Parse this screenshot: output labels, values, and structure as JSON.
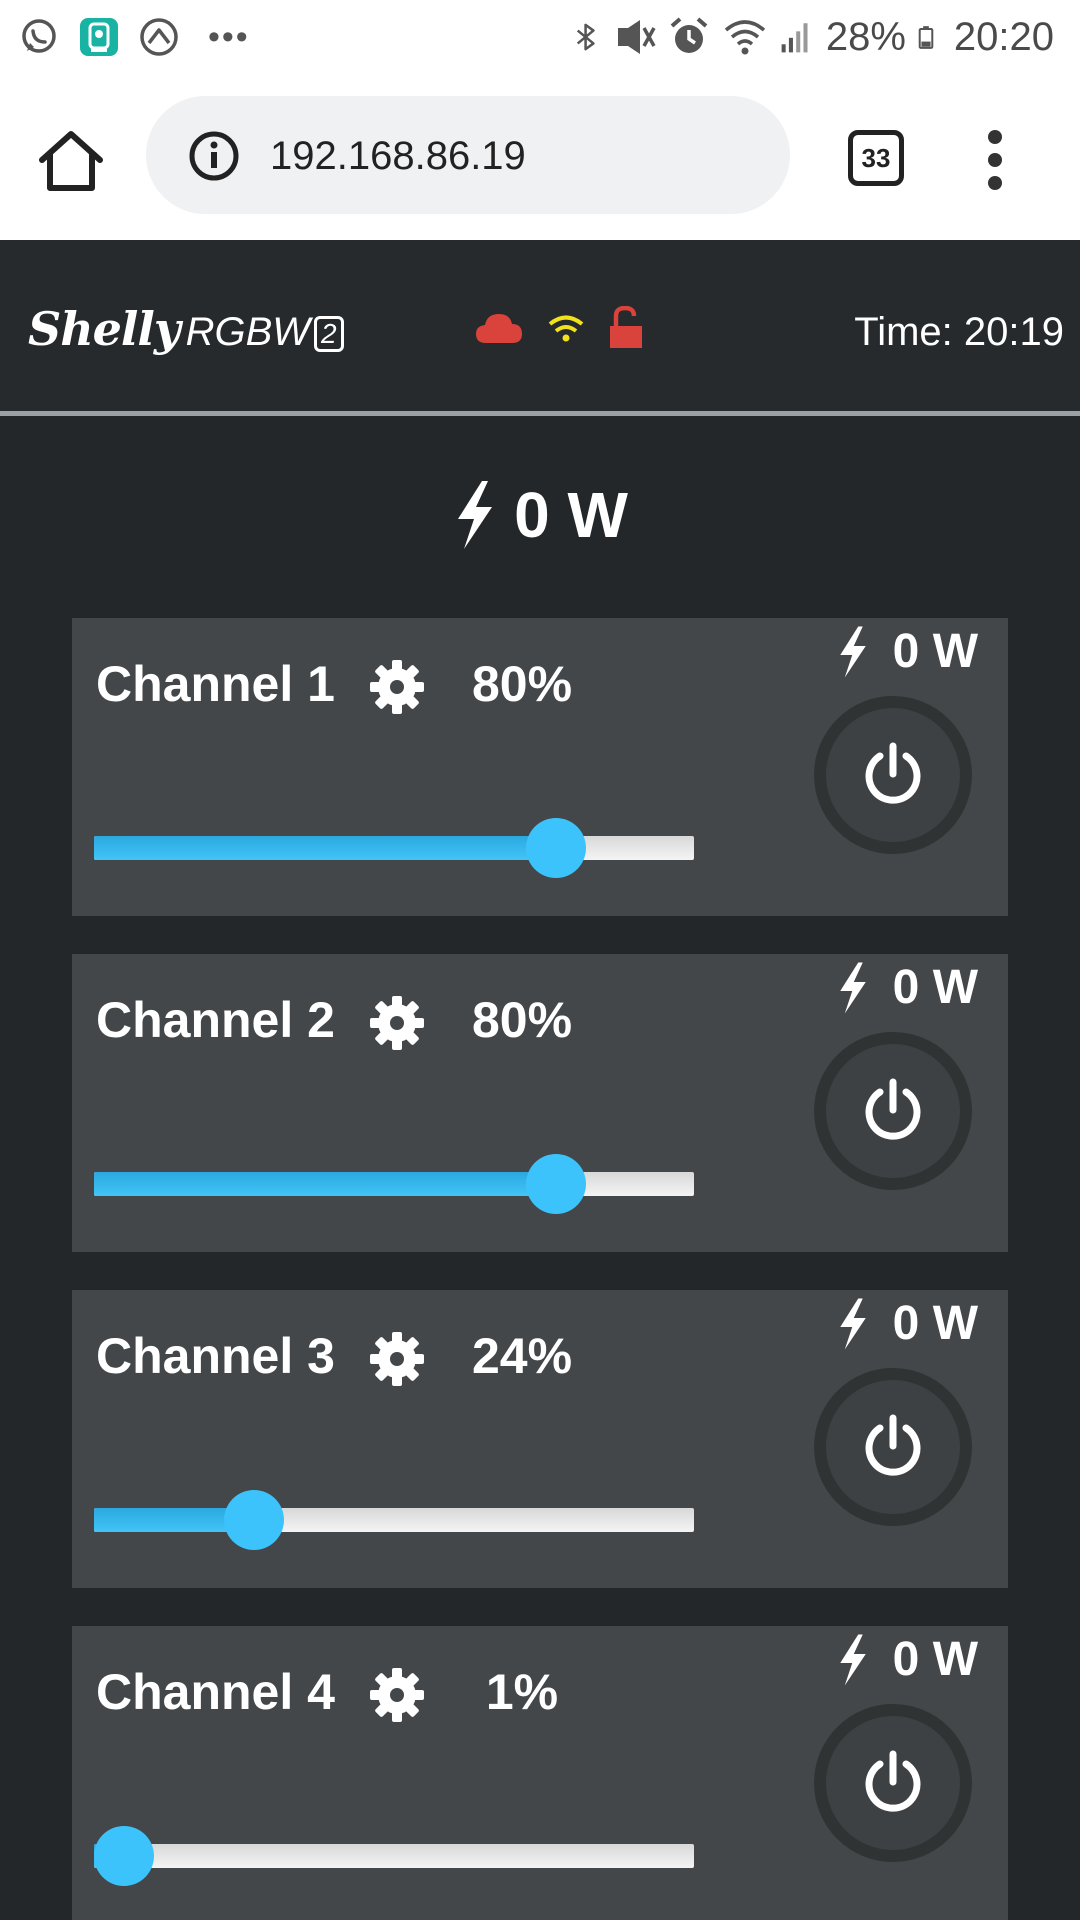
{
  "statusbar": {
    "battery": "28%",
    "clock": "20:20",
    "icons_left": [
      "whatsapp-icon",
      "camera-app-icon",
      "navigation-icon",
      "more-notifications-icon"
    ],
    "icons_right": [
      "bluetooth-icon",
      "mute-icon",
      "alarm-icon",
      "wifi-icon",
      "signal-icon",
      "battery-icon"
    ]
  },
  "browser": {
    "url": "192.168.86.19",
    "tab_count": "33"
  },
  "app": {
    "brand": "Shelly",
    "model": "RGBW",
    "model_suffix": "2",
    "time": "Time: 20:19",
    "status_icons": {
      "cloud": "#d9433c",
      "wifi": "#f2e21b",
      "lock": "#d9433c"
    },
    "total_power": "0 W"
  },
  "colors": {
    "accent": "#3cc3fb",
    "background": "#232729",
    "card": "#434749"
  },
  "channels": [
    {
      "name": "Channel 1",
      "percent": "80%",
      "level": 0.77,
      "power": "0 W"
    },
    {
      "name": "Channel 2",
      "percent": "80%",
      "level": 0.77,
      "power": "0 W"
    },
    {
      "name": "Channel 3",
      "percent": "24%",
      "level": 0.267,
      "power": "0 W"
    },
    {
      "name": "Channel 4",
      "percent": "1%",
      "level": 0.05,
      "power": "0 W"
    }
  ]
}
